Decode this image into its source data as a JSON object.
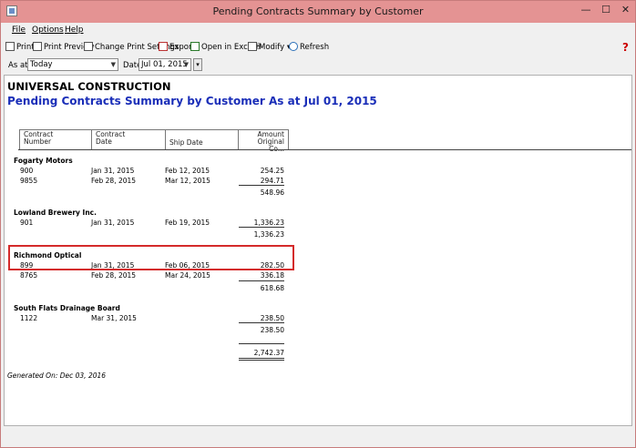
{
  "window": {
    "title": "Pending Contracts Summary by Customer"
  },
  "window_controls": {
    "minimize": "—",
    "maximize": "☐",
    "close": "✕"
  },
  "menu": {
    "file": "File",
    "options": "Options",
    "help": "Help"
  },
  "toolbar": {
    "print": "Print",
    "print_preview": "Print Preview",
    "change_print_settings": "Change Print Settings",
    "export": "Export",
    "open_in_excel": "Open in Excel®",
    "modify": "Modify",
    "refresh": "Refresh",
    "help_icon": "?"
  },
  "filters": {
    "as_at_label": "As at:",
    "as_at_value": "Today",
    "date_label": "Date:",
    "date_value": "Jul 01, 2015"
  },
  "report": {
    "company": "UNIVERSAL CONSTRUCTION",
    "title": "Pending Contracts Summary by Customer As at Jul 01, 2015",
    "columns": {
      "contract_number": [
        "Contract",
        "Number"
      ],
      "contract_date": [
        "Contract",
        "Date"
      ],
      "ship_date": "Ship Date",
      "amount": [
        "Amount",
        "Original Co..."
      ]
    },
    "customers": [
      {
        "name": "Fogarty Motors",
        "rows": [
          {
            "number": "900",
            "date": "Jan 31, 2015",
            "ship": "Feb 12, 2015",
            "amount": "254.25"
          },
          {
            "number": "9855",
            "date": "Feb 28, 2015",
            "ship": "Mar 12, 2015",
            "amount": "294.71"
          }
        ],
        "subtotal": "548.96"
      },
      {
        "name": "Lowland Brewery Inc.",
        "rows": [
          {
            "number": "901",
            "date": "Jan 31, 2015",
            "ship": "Feb 19, 2015",
            "amount": "1,336.23"
          }
        ],
        "subtotal": "1,336.23"
      },
      {
        "name": "Richmond Optical",
        "rows": [
          {
            "number": "899",
            "date": "Jan 31, 2015",
            "ship": "Feb 06, 2015",
            "amount": "282.50"
          },
          {
            "number": "8765",
            "date": "Feb 28, 2015",
            "ship": "Mar 24, 2015",
            "amount": "336.18"
          }
        ],
        "subtotal": "618.68"
      },
      {
        "name": "South Flats Drainage Board",
        "rows": [
          {
            "number": "1122",
            "date": "Mar 31, 2015",
            "ship": "",
            "amount": "238.50"
          }
        ],
        "subtotal": "238.50"
      }
    ],
    "grand_total": "2,742.37",
    "generated_on": "Generated On: Dec 03, 2016"
  },
  "colors": {
    "title_bar": "#e49393",
    "report_title": "#1a2eb8",
    "highlight_box": "#d42a2a"
  }
}
